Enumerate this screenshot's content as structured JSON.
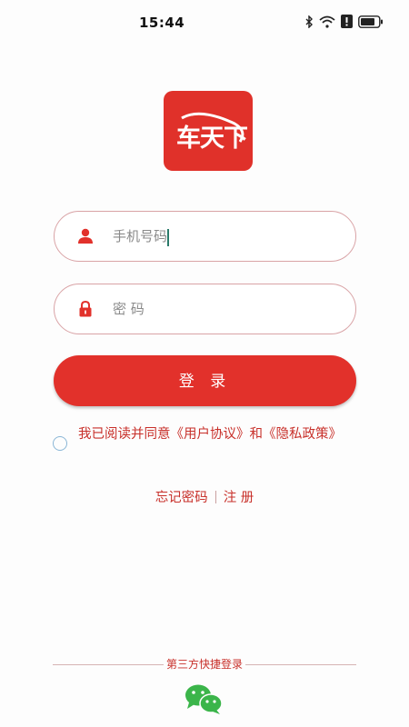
{
  "status_bar": {
    "time": "15:44"
  },
  "logo": {
    "text": "车天下",
    "color": "#e0312a"
  },
  "form": {
    "phone_placeholder": "手机号码",
    "password_placeholder": "密 码",
    "login_label": "登 录"
  },
  "agreement": {
    "text": "我已阅读并同意《用户协议》和《隐私政策》"
  },
  "links": {
    "forgot_password": "忘记密码",
    "register": "注 册"
  },
  "third_party": {
    "label": "第三方快捷登录",
    "icon": "wechat-icon"
  },
  "colors": {
    "accent": "#e2312b",
    "text_red": "#c8302a",
    "border": "#d9a3a6"
  }
}
